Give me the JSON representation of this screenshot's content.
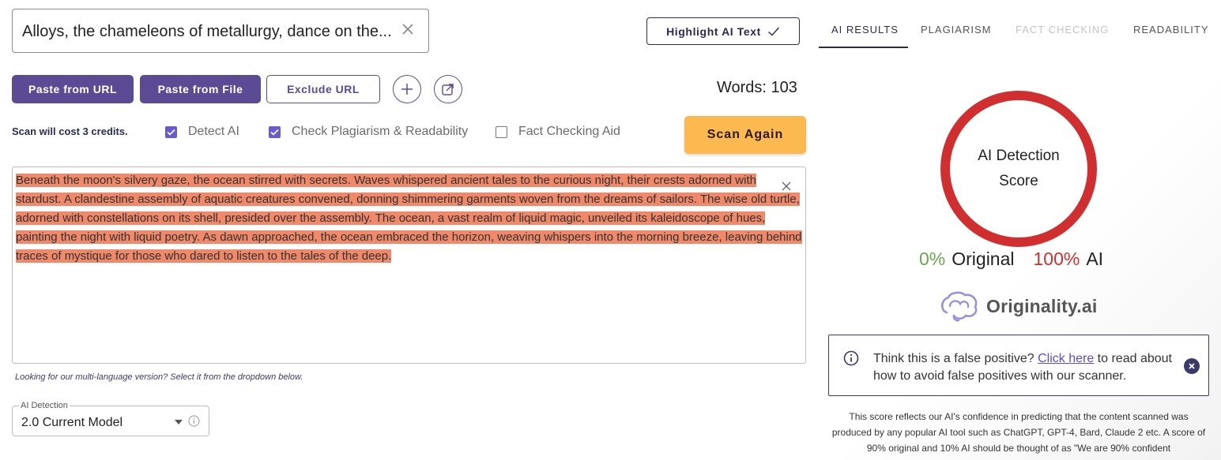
{
  "title_input": {
    "value": "Alloys, the chameleons of metallurgy, dance on the..."
  },
  "highlight_button": {
    "label": "Highlight AI Text"
  },
  "toolbar": {
    "paste_url": "Paste from URL",
    "paste_file": "Paste from File",
    "exclude_url": "Exclude URL"
  },
  "word_count": "Words: 103",
  "scan_cost": "Scan will cost 3 credits.",
  "options": {
    "detect_ai": {
      "label": "Detect AI",
      "checked": true
    },
    "check_plagiarism": {
      "label": "Check Plagiarism & Readability",
      "checked": true
    },
    "fact_checking": {
      "label": "Fact Checking Aid",
      "checked": false
    }
  },
  "scan_button": "Scan Again",
  "editor": {
    "text": "Beneath the moon's silvery gaze, the ocean stirred with secrets. Waves whispered ancient tales to the curious night, their crests adorned with stardust. A clandestine assembly of aquatic creatures convened, donning shimmering garments woven from the dreams of sailors. The wise old turtle, adorned with constellations on its shell, presided over the assembly. The ocean, a vast realm of liquid magic, unveiled its kaleidoscope of hues, painting the night with liquid poetry. As dawn approached, the ocean embraced the horizon, weaving whispers into the morning breeze, leaving behind traces of mystique for those who dared to listen to the tales of the deep.",
    "highlight_color": "#f0896a"
  },
  "multi_language_hint": "Looking for our multi-language version? Select it from the dropdown below.",
  "model_select": {
    "label": "AI Detection",
    "value": "2.0 Current Model"
  },
  "tabs": [
    {
      "label": "AI RESULTS",
      "active": true
    },
    {
      "label": "PLAGIARISM",
      "active": false
    },
    {
      "label": "FACT CHECKING",
      "active": false,
      "disabled": true
    },
    {
      "label": "READABILITY",
      "active": false
    }
  ],
  "score": {
    "label": "AI Detection Score",
    "original_pct": "0%",
    "original_label": "Original",
    "ai_pct": "100%",
    "ai_label": "AI",
    "ring_color": "#d12f2f"
  },
  "brand": {
    "name": "Originality.ai"
  },
  "notice": {
    "before": "Think this is a false positive? ",
    "link": "Click here",
    "after": " to read about how to avoid false positives with our scanner."
  },
  "description": "This score reflects our AI's confidence in predicting that the content scanned was produced by any popular AI tool such as ChatGPT, GPT-4, Bard, Claude 2 etc. A score of 90% original and 10% AI should be thought of as \"We are 90% confident",
  "colors": {
    "primary": "#5b4b94",
    "navy": "#2b2a52",
    "scan": "#fbb94f",
    "green": "#6aa84f",
    "red": "#d12f2f"
  }
}
